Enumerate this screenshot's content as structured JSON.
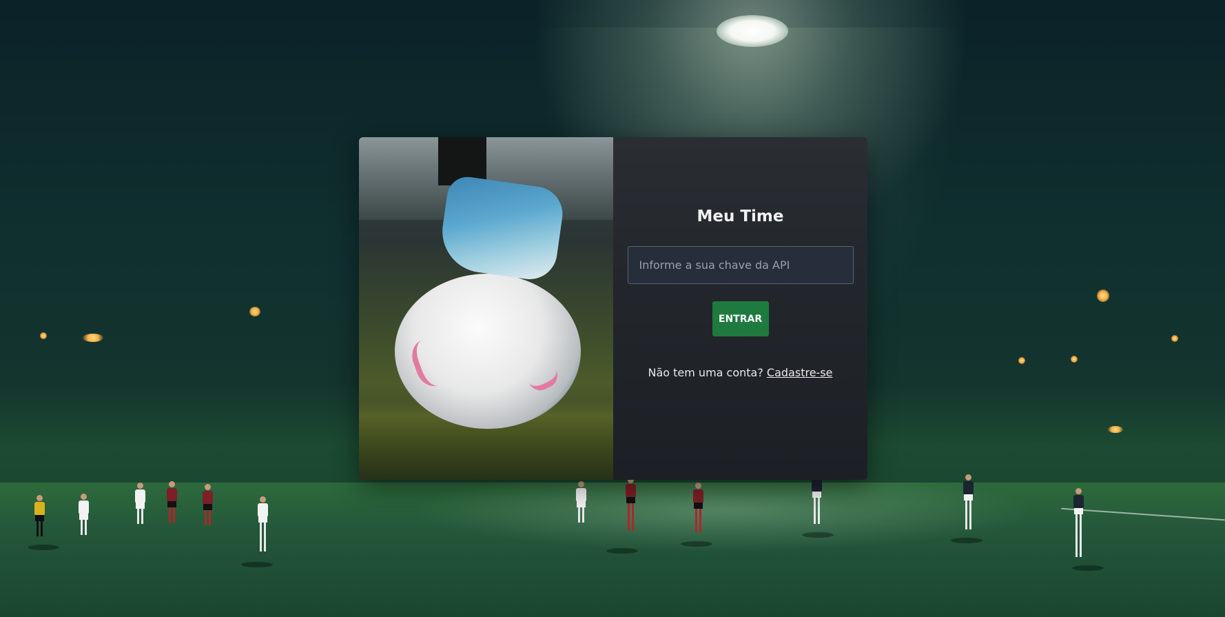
{
  "login": {
    "title": "Meu Time",
    "api_key_input": {
      "value": "",
      "placeholder": "Informe a sua chave da API"
    },
    "enter_button_label": "ENTRAR",
    "signup_prompt": "Não tem uma conta?",
    "signup_link_label": "Cadastre-se"
  },
  "colors": {
    "button_green": "#1e7a3e",
    "card_panel": "#23272c",
    "input_background": "#262d3b"
  },
  "icons": {
    "stadium_light": "stadium-floodlight",
    "hero_photo": "soccer-cleat-on-ball-photo"
  }
}
